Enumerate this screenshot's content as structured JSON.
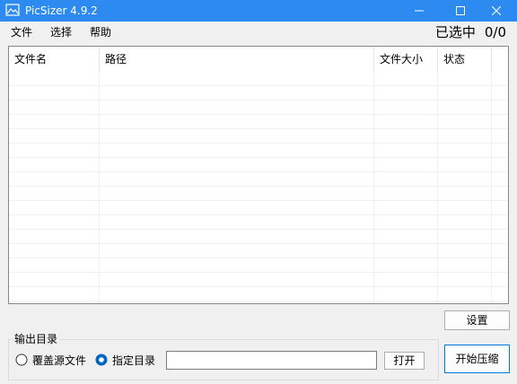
{
  "window": {
    "title": "PicSizer 4.9.2"
  },
  "menu": [
    "文件",
    "选择",
    "帮助"
  ],
  "selection": {
    "label": "已选中",
    "count": "0/0"
  },
  "table": {
    "columns": [
      "文件名",
      "路径",
      "文件大小",
      "状态"
    ],
    "rows": []
  },
  "buttons": {
    "settings": "设置",
    "open": "打开",
    "start": "开始压缩"
  },
  "output": {
    "group_label": "输出目录",
    "options": [
      "覆盖源文件",
      "指定目录"
    ],
    "selected_option": "指定目录",
    "directory_value": ""
  },
  "colors": {
    "titlebar": "#2c8af0",
    "radio_selected": "#0067c0"
  },
  "icons": [
    "app-icon",
    "minimize-icon",
    "maximize-icon",
    "close-icon"
  ]
}
